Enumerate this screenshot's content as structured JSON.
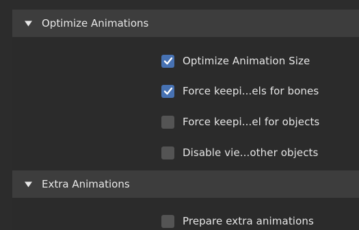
{
  "sections": [
    {
      "title": "Optimize Animations",
      "expanded": true,
      "options": [
        {
          "label": "Optimize Animation Size",
          "checked": true
        },
        {
          "label": "Force keepi...els for bones",
          "checked": true
        },
        {
          "label": "Force keepi...el for objects",
          "checked": false
        },
        {
          "label": "Disable vie...other objects",
          "checked": false
        }
      ]
    },
    {
      "title": "Extra Animations",
      "expanded": true,
      "options": [
        {
          "label": "Prepare extra animations",
          "checked": false
        }
      ]
    }
  ],
  "colors": {
    "background": "#2c2c2c",
    "header": "#3d3d3d",
    "checkbox_checked": "#4772b3",
    "checkbox_unchecked": "#545454",
    "text": "#e6e6e6"
  },
  "icons": {
    "expanded_arrow": "triangle-down-icon",
    "check": "checkmark-icon"
  }
}
